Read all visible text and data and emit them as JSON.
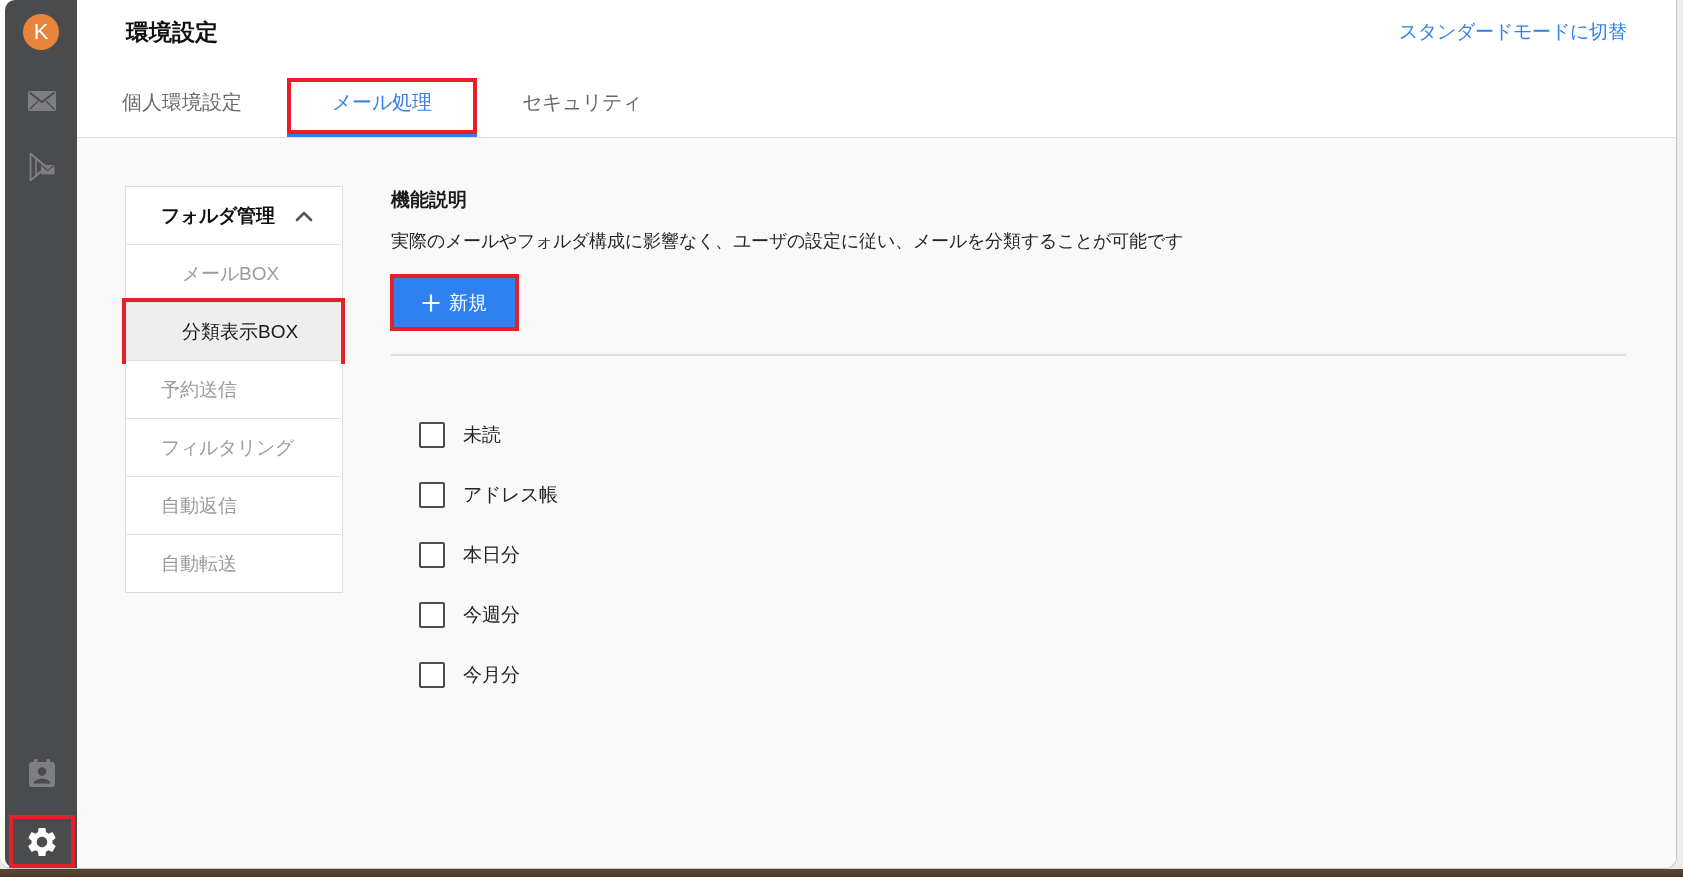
{
  "rail": {
    "avatar": {
      "initial": "K"
    },
    "top_items": [
      {
        "kind": "mail",
        "selected": false,
        "highlighted": false
      },
      {
        "kind": "send",
        "selected": false,
        "highlighted": false
      }
    ],
    "bottom_items": [
      {
        "kind": "contacts",
        "selected": false,
        "highlighted": false
      },
      {
        "kind": "settings",
        "selected": true,
        "highlighted": true
      }
    ]
  },
  "header": {
    "title": "環境設定",
    "mode_link": "スタンダードモードに切替"
  },
  "tabs": [
    {
      "label": "個人環境設定",
      "selected": false,
      "highlighted": false
    },
    {
      "label": "メール処理",
      "selected": true,
      "highlighted": true
    },
    {
      "label": "セキュリティ",
      "selected": false,
      "highlighted": false
    }
  ],
  "side_menu": {
    "items": [
      {
        "label": "フォルダ管理",
        "expanded": true,
        "selected": false,
        "highlighted": false,
        "children": [
          {
            "label": "メールBOX",
            "selected": false,
            "highlighted": false
          },
          {
            "label": "分類表示BOX",
            "selected": true,
            "highlighted": true
          }
        ]
      },
      {
        "label": "予約送信",
        "selected": false,
        "highlighted": false
      },
      {
        "label": "フィルタリング",
        "selected": false,
        "highlighted": false
      },
      {
        "label": "自動返信",
        "selected": false,
        "highlighted": false
      },
      {
        "label": "自動転送",
        "selected": false,
        "highlighted": false
      }
    ]
  },
  "content": {
    "heading": "機能説明",
    "description": "実際のメールやフォルダ構成に影響なく、ユーザの設定に従い、メールを分類することが可能です",
    "new_button": {
      "label": "新規",
      "highlighted": true
    },
    "filters": [
      {
        "label": "未読",
        "checked": false
      },
      {
        "label": "アドレス帳",
        "checked": false
      },
      {
        "label": "本日分",
        "checked": false
      },
      {
        "label": "今週分",
        "checked": false
      },
      {
        "label": "今月分",
        "checked": false
      }
    ]
  }
}
